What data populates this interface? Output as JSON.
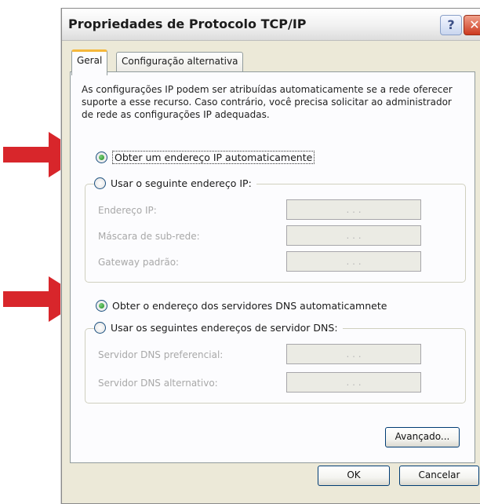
{
  "window": {
    "title": "Propriedades de Protocolo TCP/IP",
    "help_glyph": "?",
    "close_glyph": "✕"
  },
  "tabs": [
    {
      "label": "Geral",
      "selected": true
    },
    {
      "label": "Configuração alternativa",
      "selected": false
    }
  ],
  "description": "As configurações IP podem ser atribuídas automaticamente se a rede oferecer suporte a esse recurso. Caso contrário, você precisa solicitar ao administrador de rede as configurações IP adequadas.",
  "ip": {
    "auto_label": "Obter um endereço IP automaticamente",
    "auto_selected": true,
    "manual_label": "Usar o seguinte endereço IP:",
    "manual_selected": false,
    "fields": [
      {
        "label": "Endereço IP:",
        "value": ". . ."
      },
      {
        "label": "Máscara de sub-rede:",
        "value": ". . ."
      },
      {
        "label": "Gateway padrão:",
        "value": ". . ."
      }
    ]
  },
  "dns": {
    "auto_label": "Obter o endereço dos servidores DNS automaticamnete",
    "auto_selected": true,
    "manual_label": "Usar os seguintes endereços de servidor DNS:",
    "manual_selected": false,
    "fields": [
      {
        "label": "Servidor DNS preferencial:",
        "value": ". . ."
      },
      {
        "label": "Servidor DNS alternativo:",
        "value": ". . ."
      }
    ]
  },
  "buttons": {
    "advanced": "Avançado...",
    "ok": "OK",
    "cancel": "Cancelar"
  },
  "colors": {
    "annotation_arrow": "#d8262b",
    "selected_tab_accent": "#f5b73b",
    "dialog_background": "#ece9d8"
  },
  "icons": [
    "help-icon",
    "close-icon",
    "red-arrow-annotation-icon"
  ]
}
